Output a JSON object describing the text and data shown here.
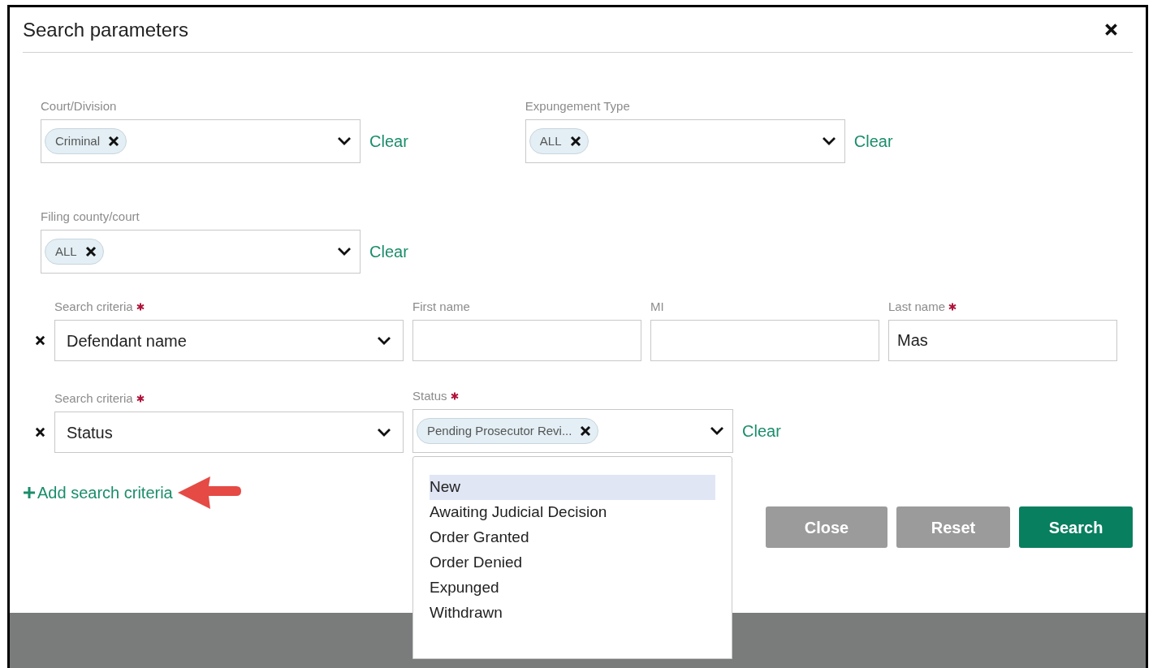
{
  "dialog": {
    "title": "Search parameters"
  },
  "filters": [
    {
      "label": "Court/Division",
      "chips": [
        "Criminal"
      ],
      "clear": "Clear"
    },
    {
      "label": "Expungement Type",
      "chips": [
        "ALL"
      ],
      "clear": "Clear"
    },
    {
      "label": "Filing county/court",
      "chips": [
        "ALL"
      ],
      "clear": "Clear"
    }
  ],
  "criteria": [
    {
      "label": "Search criteria",
      "required": true,
      "value": "Defendant name",
      "fields": [
        {
          "kind": "text",
          "label": "First name",
          "required": false
        },
        {
          "kind": "text",
          "label": "MI",
          "required": false
        },
        {
          "kind": "text",
          "label": "Last name",
          "required": true,
          "value": "Mas"
        }
      ]
    },
    {
      "label": "Search criteria",
      "required": true,
      "value": "Status",
      "fields": [
        {
          "kind": "multi",
          "label": "Status",
          "required": true,
          "chips": [
            "Pending Prosecutor Revi..."
          ],
          "clear": "Clear",
          "open": true,
          "options": [
            {
              "label": "New",
              "highlighted": true
            },
            {
              "label": "Awaiting Judicial Decision",
              "highlighted": false
            },
            {
              "label": "Order Granted",
              "highlighted": false
            },
            {
              "label": "Order Denied",
              "highlighted": false
            },
            {
              "label": "Expunged",
              "highlighted": false
            },
            {
              "label": "Withdrawn",
              "highlighted": false
            }
          ]
        }
      ]
    }
  ],
  "add_criteria": "Add search criteria",
  "buttons": [
    {
      "label": "Close",
      "kind": "secondary"
    },
    {
      "label": "Reset",
      "kind": "secondary"
    },
    {
      "label": "Search",
      "kind": "primary"
    }
  ]
}
